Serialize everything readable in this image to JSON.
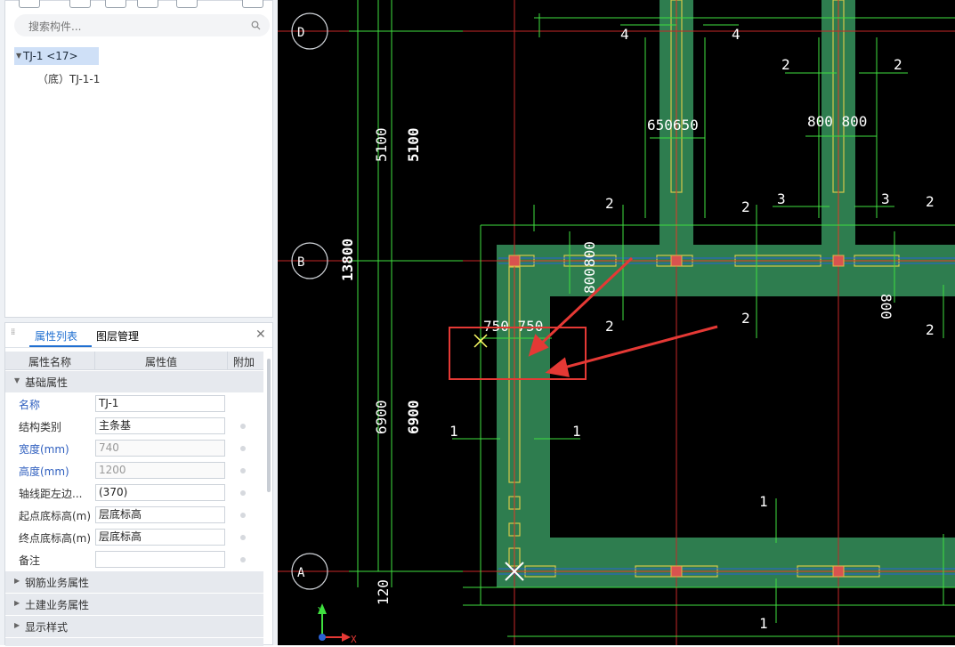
{
  "left_panel": {
    "search": {
      "placeholder": "搜索构件..."
    },
    "tree": {
      "root_label": "TJ-1 <17>",
      "child_label": "（底）TJ-1-1"
    }
  },
  "properties": {
    "tabs": [
      "属性列表",
      "图层管理"
    ],
    "headers": [
      "属性名称",
      "属性值",
      "附加"
    ],
    "section_basic": "基础属性",
    "rows": [
      {
        "name": "名称",
        "value": "TJ-1"
      },
      {
        "name": "结构类别",
        "value": "主条基"
      },
      {
        "name": "宽度(mm)",
        "value": "740"
      },
      {
        "name": "高度(mm)",
        "value": "1200"
      },
      {
        "name": "轴线距左边...",
        "value": "(370)"
      },
      {
        "name": "起点底标高(m)",
        "value": "层底标高"
      },
      {
        "name": "终点底标高(m)",
        "value": "层底标高"
      },
      {
        "name": "备注",
        "value": ""
      }
    ],
    "groups": [
      "钢筋业务属性",
      "土建业务属性",
      "显示样式"
    ]
  },
  "cad": {
    "axis_labels": [
      "D",
      "B",
      "A"
    ],
    "dims": {
      "d5100": "5100",
      "d6900": "6900",
      "d13800": "13800",
      "d120": "120",
      "d650": "650650",
      "d800a": "800 800",
      "d800b": "800",
      "d800c": "800",
      "d800d": "800",
      "d750": "750 750",
      "d4": "4",
      "d1": "1",
      "d2": "2",
      "d3": "3"
    },
    "ucs": {
      "x": "X",
      "y": "Y"
    }
  }
}
